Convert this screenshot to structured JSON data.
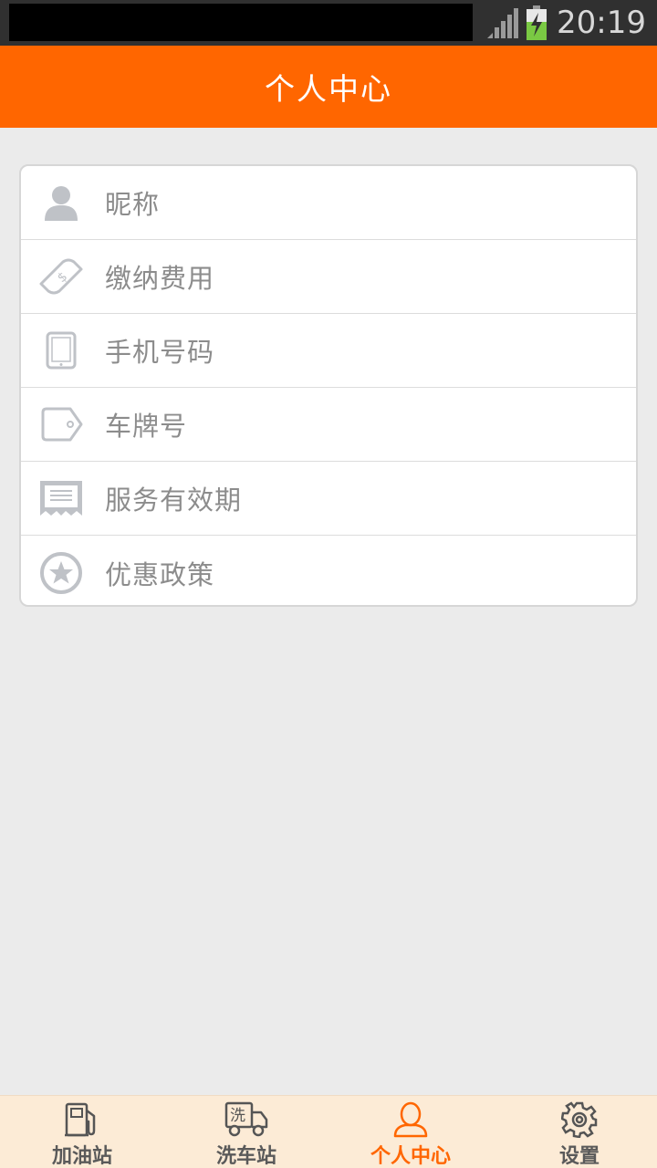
{
  "status_bar": {
    "time": "20:19"
  },
  "header": {
    "title": "个人中心"
  },
  "menu": {
    "items": [
      {
        "label": "昵称",
        "icon": "user-icon"
      },
      {
        "label": "缴纳费用",
        "icon": "money-icon"
      },
      {
        "label": "手机号码",
        "icon": "phone-icon"
      },
      {
        "label": "车牌号",
        "icon": "tag-icon"
      },
      {
        "label": "服务有效期",
        "icon": "receipt-icon"
      },
      {
        "label": "优惠政策",
        "icon": "star-icon"
      }
    ]
  },
  "tabbar": {
    "tabs": [
      {
        "label": "加油站",
        "icon": "fuel-pump-icon"
      },
      {
        "label": "洗车站",
        "icon": "car-wash-truck-icon",
        "icon_text": "洗"
      },
      {
        "label": "个人中心",
        "icon": "person-icon",
        "active": true
      },
      {
        "label": "设置",
        "icon": "gear-icon"
      }
    ]
  },
  "colors": {
    "accent": "#ff6600",
    "background": "#ebebeb",
    "tabbar_bg": "#fcebd6",
    "icon_gray": "#b4b8bf"
  }
}
